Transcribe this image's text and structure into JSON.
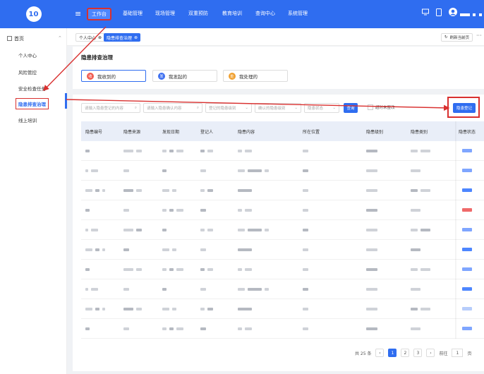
{
  "app": {
    "logo_text": "10"
  },
  "topnav": {
    "items": [
      {
        "label": "工作台",
        "active": true
      },
      {
        "label": "基础管理"
      },
      {
        "label": "现场管理"
      },
      {
        "label": "双重预防"
      },
      {
        "label": "教育培训"
      },
      {
        "label": "查询中心"
      },
      {
        "label": "系统管理"
      }
    ]
  },
  "sidebar": {
    "home_label": "首页",
    "items": [
      {
        "label": "个人中心"
      },
      {
        "label": "风险管控"
      },
      {
        "label": "安全检查任务"
      },
      {
        "label": "隐患排查治理",
        "active": true
      },
      {
        "label": "线上培训"
      }
    ]
  },
  "tabs": {
    "items": [
      {
        "label": "个人中心"
      },
      {
        "label": "隐患排查治理",
        "active": true
      }
    ],
    "refresh_label": "刷新当前页",
    "more_label": "···"
  },
  "page": {
    "title": "隐患排查治理",
    "filters": [
      {
        "label": "我收到的",
        "icon_char": "收",
        "color": "#f05a4f",
        "selected": true
      },
      {
        "label": "我发起的",
        "icon_char": "发",
        "color": "#3d6ff0"
      },
      {
        "label": "我处理的",
        "icon_char": "处",
        "color": "#f0a030"
      }
    ]
  },
  "search": {
    "field1_placeholder": "请输入隐患登记的内容",
    "field2_placeholder": "请输入隐患确认内容",
    "field3_placeholder": "登记的隐患级别",
    "field4_placeholder": "确认的隐患级别",
    "field5_placeholder": "隐患状态",
    "query_label": "查询",
    "checkbox_label": "超时未整改",
    "register_label": "隐患登记"
  },
  "table": {
    "columns": [
      "隐患编号",
      "隐患来源",
      "发现日期",
      "登记人",
      "隐患内容",
      "所在位置",
      "隐患级别",
      "隐患类别",
      "隐患状态"
    ],
    "status_colors": [
      "#7fa6ff",
      "#7fa6ff",
      "#4d86ff",
      "#ef6a6a",
      "#7fa6ff",
      "#4d86ff",
      "#7fa6ff",
      "#4d86ff",
      "#b7cdfb",
      "#7fa6ff"
    ]
  },
  "pager": {
    "total_text": "共 25 条",
    "prev": "‹",
    "pages": [
      "1",
      "2",
      "3"
    ],
    "next": "›",
    "goto_label": "前往",
    "goto_value": "1",
    "page_suffix": "页"
  }
}
